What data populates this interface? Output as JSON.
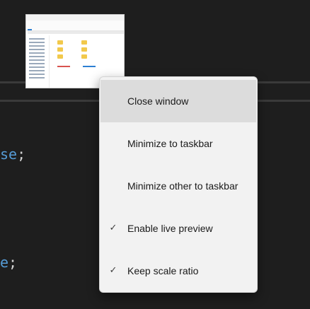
{
  "background_code": {
    "line1_keyword": "se",
    "line1_punct": ";",
    "line2_keyword": "e",
    "line2_punct": ";"
  },
  "thumbnail": {
    "title": "File Explorer window preview"
  },
  "context_menu": {
    "items": [
      {
        "label": "Close window",
        "checked": false,
        "hovered": true
      },
      {
        "label": "Minimize to taskbar",
        "checked": false,
        "hovered": false
      },
      {
        "label": "Minimize other to taskbar",
        "checked": false,
        "hovered": false
      },
      {
        "label": "Enable live preview",
        "checked": true,
        "hovered": false
      },
      {
        "label": "Keep scale ratio",
        "checked": true,
        "hovered": false
      }
    ],
    "check_glyph": "✓"
  },
  "colors": {
    "background": "#1e1e1e",
    "menu_background": "#f2f2f2",
    "menu_hover": "#dcdcdc",
    "code_keyword": "#569cd6"
  }
}
